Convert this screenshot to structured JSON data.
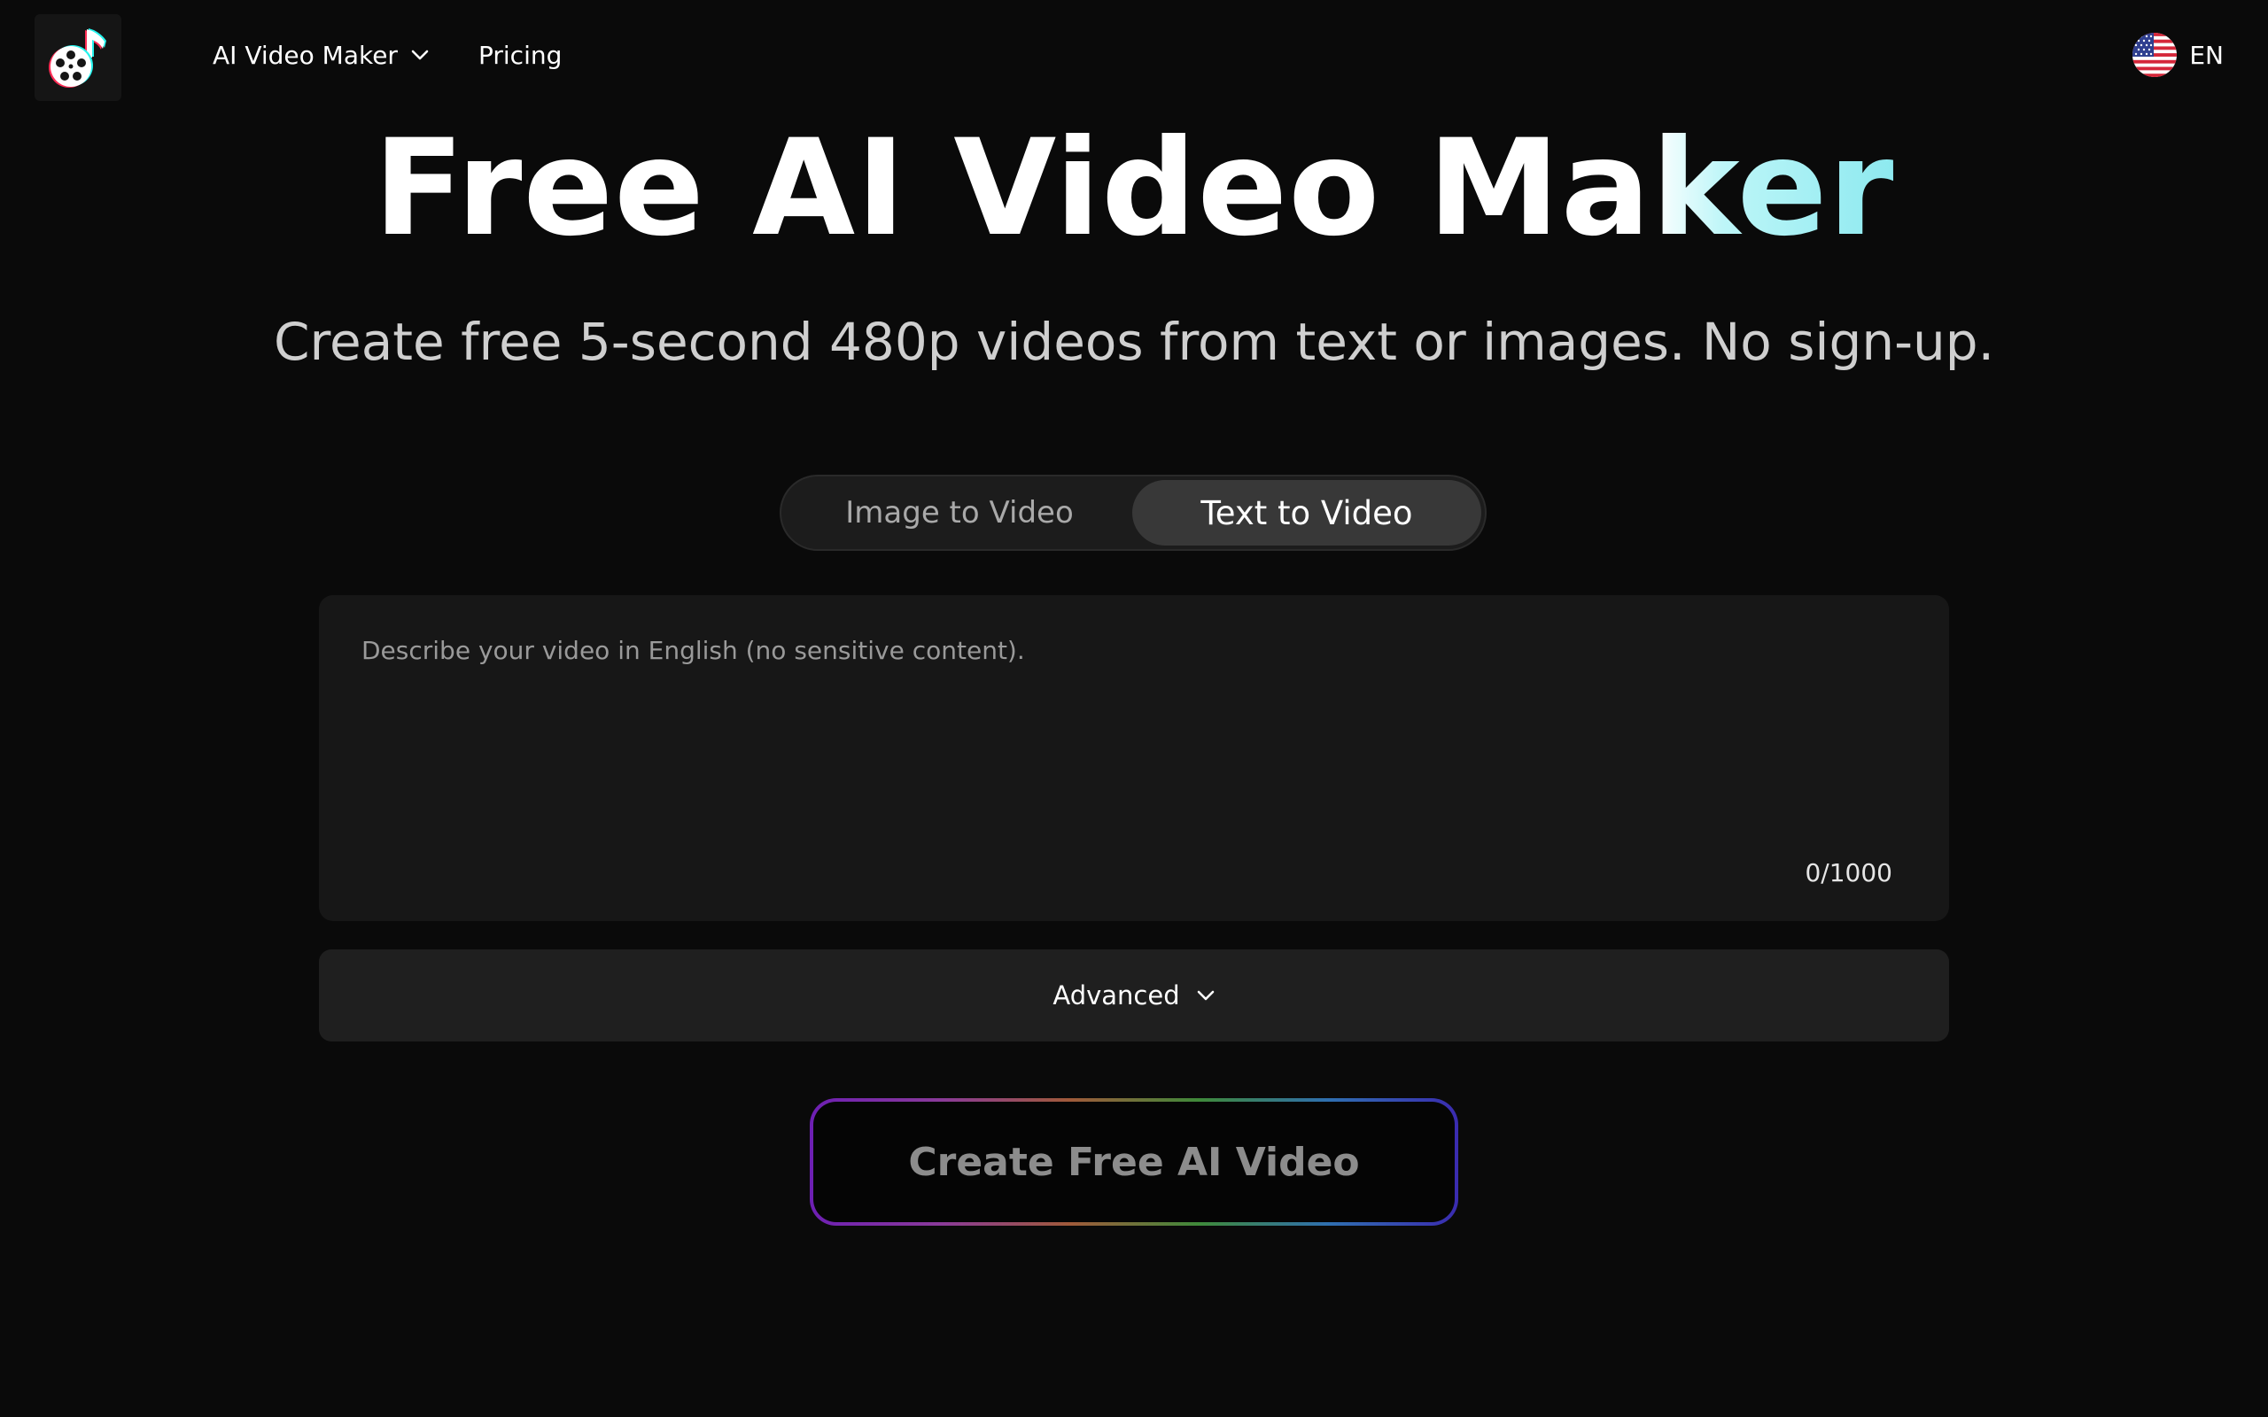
{
  "header": {
    "logo_icon": "film-reel-music-note-icon",
    "nav": [
      {
        "label": "AI Video Maker",
        "has_dropdown": true
      },
      {
        "label": "Pricing",
        "has_dropdown": false
      }
    ],
    "language": {
      "flag_icon": "us-flag-icon",
      "code": "EN"
    }
  },
  "hero": {
    "title_main": "Free AI Video Ma",
    "title_accent": "ker",
    "subtitle": "Create free 5-second 480p videos from text or images. No sign-up."
  },
  "tabs": {
    "items": [
      "Image to Video",
      "Text to Video"
    ],
    "selected": "Text to Video"
  },
  "prompt": {
    "value": "",
    "placeholder": "Describe your video in English (no sensitive content).",
    "counter": "0/1000"
  },
  "advanced": {
    "label": "Advanced"
  },
  "create_button": {
    "label": "Create Free AI Video"
  },
  "colors": {
    "background": "#0a0a0a",
    "panel": "#171717",
    "tab_active": "#383838",
    "title_accent": "#8de9ef"
  }
}
